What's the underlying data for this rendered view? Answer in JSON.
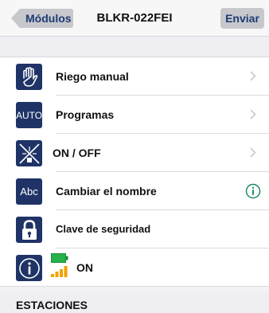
{
  "navbar": {
    "back_label": "Módulos",
    "title": "BLKR-022FEI",
    "send_label": "Enviar"
  },
  "menu": {
    "items": [
      {
        "label": "Riego manual",
        "icon": "hand-icon",
        "accessory": "chevron"
      },
      {
        "label": "Programas",
        "icon": "auto-icon",
        "icon_text": "AUTO",
        "accessory": "chevron"
      },
      {
        "label": "ON / OFF",
        "icon": "sprinkler-off-icon",
        "accessory": "chevron"
      },
      {
        "label": "Cambiar el nombre",
        "icon": "abc-icon",
        "icon_text": "Abc",
        "accessory": "info"
      },
      {
        "label": "Clave de seguridad",
        "icon": "lock-icon",
        "accessory": "none"
      },
      {
        "label": "ON",
        "icon": "info-icon",
        "accessory": "none",
        "battery": "battery-icon",
        "signal": "signal-icon"
      }
    ]
  },
  "stations": {
    "header": "ESTACIONES"
  },
  "colors": {
    "icon_bg": "#1f3366",
    "nav_text": "#1d3b72",
    "accent_info": "#1f8a6a",
    "battery": "#27b34a",
    "signal": "#f2a100"
  }
}
